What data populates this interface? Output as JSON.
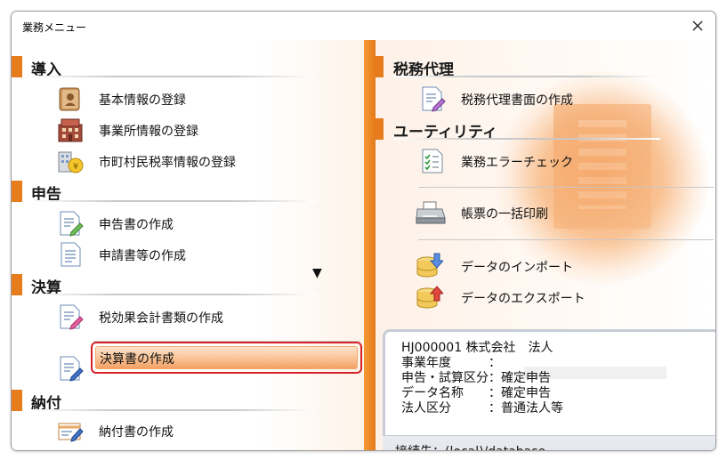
{
  "window": {
    "title": "業務メニュー"
  },
  "colors": {
    "accent": "#e67c1c",
    "selected_border": "#d8222a"
  },
  "left": {
    "sections": [
      {
        "title": "導入",
        "items": [
          {
            "label": "基本情報の登録",
            "icon": "address-book-icon"
          },
          {
            "label": "事業所情報の登録",
            "icon": "office-building-icon"
          },
          {
            "label": "市町村民税率情報の登録",
            "icon": "city-tax-yen-icon"
          }
        ]
      },
      {
        "title": "申告",
        "items": [
          {
            "label": "申告書の作成",
            "icon": "document-edit-icon"
          },
          {
            "label": "申請書等の作成",
            "icon": "document-list-icon"
          }
        ]
      },
      {
        "title": "決算",
        "items": [
          {
            "label": "税効果会計書類の作成",
            "icon": "document-pen-icon"
          },
          {
            "label": "決算書の作成",
            "icon": "document-blue-pen-icon"
          }
        ]
      },
      {
        "title": "納付",
        "items": [
          {
            "label": "納付書の作成",
            "icon": "payment-slip-icon"
          }
        ]
      }
    ],
    "dropdown_arrow": "▼"
  },
  "right": {
    "sections": [
      {
        "title": "税務代理",
        "items": [
          {
            "label": "税務代理書面の作成",
            "icon": "document-pen-icon"
          }
        ]
      },
      {
        "title": "ユーティリティ",
        "items": [
          {
            "label": "業務エラーチェック",
            "icon": "checklist-icon"
          },
          {
            "label": "帳票の一括印刷",
            "icon": "printer-icon"
          },
          {
            "label": "データのインポート",
            "icon": "database-import-icon"
          },
          {
            "label": "データのエクスポート",
            "icon": "database-export-icon"
          }
        ]
      }
    ]
  },
  "info": {
    "company": "HJ000001 株式会社　法人",
    "business_year": "事業年度　　　：",
    "return_type": "申告・試算区分：確定申告",
    "data_name": "データ名称　　：確定申告",
    "corp_type": "法人区分　　　：普通法人等",
    "connection": "接続先：(local)/database"
  }
}
